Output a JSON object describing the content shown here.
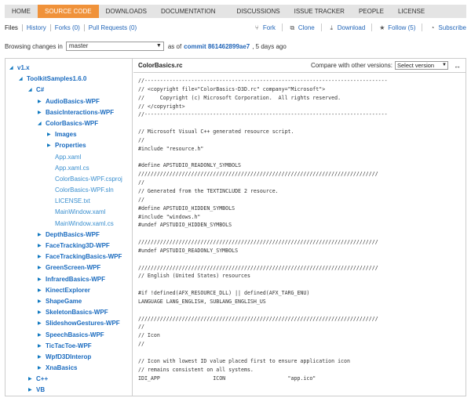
{
  "nav": {
    "tabs": [
      {
        "label": "HOME",
        "active": false
      },
      {
        "label": "SOURCE CODE",
        "active": true
      },
      {
        "label": "DOWNLOADS",
        "active": false
      },
      {
        "label": "DOCUMENTATION",
        "active": false
      },
      {
        "label": "DISCUSSIONS",
        "active": false
      },
      {
        "label": "ISSUE TRACKER",
        "active": false
      },
      {
        "label": "PEOPLE",
        "active": false
      },
      {
        "label": "LICENSE",
        "active": false
      }
    ]
  },
  "toolbar": {
    "files": "Files",
    "history": "History",
    "forks": "Forks (0)",
    "pull_requests": "Pull Requests (0)",
    "fork": "Fork",
    "clone": "Clone",
    "download": "Download",
    "follow": "Follow (5)",
    "subscribe": "Subscribe"
  },
  "browse": {
    "label": "Browsing changes in",
    "branch": "master",
    "as_of": "as of",
    "commit_label": "commit 861462899ae7",
    "age": ", 5 days ago"
  },
  "tree": [
    {
      "label": "v1.x",
      "type": "folder",
      "depth": 0,
      "expanded": true
    },
    {
      "label": "ToolkitSamples1.6.0",
      "type": "folder",
      "depth": 1,
      "expanded": true
    },
    {
      "label": "C#",
      "type": "folder",
      "depth": 2,
      "expanded": true
    },
    {
      "label": "AudioBasics-WPF",
      "type": "folder",
      "depth": 3,
      "expanded": false
    },
    {
      "label": "BasicInteractions-WPF",
      "type": "folder",
      "depth": 3,
      "expanded": false
    },
    {
      "label": "ColorBasics-WPF",
      "type": "folder",
      "depth": 3,
      "expanded": true
    },
    {
      "label": "Images",
      "type": "folder",
      "depth": 4,
      "expanded": false
    },
    {
      "label": "Properties",
      "type": "folder",
      "depth": 4,
      "expanded": false
    },
    {
      "label": "App.xaml",
      "type": "file",
      "depth": 4
    },
    {
      "label": "App.xaml.cs",
      "type": "file",
      "depth": 4
    },
    {
      "label": "ColorBasics-WPF.csproj",
      "type": "file",
      "depth": 4
    },
    {
      "label": "ColorBasics-WPF.sln",
      "type": "file",
      "depth": 4
    },
    {
      "label": "LICENSE.txt",
      "type": "file",
      "depth": 4
    },
    {
      "label": "MainWindow.xaml",
      "type": "file",
      "depth": 4
    },
    {
      "label": "MainWindow.xaml.cs",
      "type": "file",
      "depth": 4
    },
    {
      "label": "DepthBasics-WPF",
      "type": "folder",
      "depth": 3,
      "expanded": false
    },
    {
      "label": "FaceTracking3D-WPF",
      "type": "folder",
      "depth": 3,
      "expanded": false
    },
    {
      "label": "FaceTrackingBasics-WPF",
      "type": "folder",
      "depth": 3,
      "expanded": false
    },
    {
      "label": "GreenScreen-WPF",
      "type": "folder",
      "depth": 3,
      "expanded": false
    },
    {
      "label": "InfraredBasics-WPF",
      "type": "folder",
      "depth": 3,
      "expanded": false
    },
    {
      "label": "KinectExplorer",
      "type": "folder",
      "depth": 3,
      "expanded": false
    },
    {
      "label": "ShapeGame",
      "type": "folder",
      "depth": 3,
      "expanded": false
    },
    {
      "label": "SkeletonBasics-WPF",
      "type": "folder",
      "depth": 3,
      "expanded": false
    },
    {
      "label": "SlideshowGestures-WPF",
      "type": "folder",
      "depth": 3,
      "expanded": false
    },
    {
      "label": "SpeechBasics-WPF",
      "type": "folder",
      "depth": 3,
      "expanded": false
    },
    {
      "label": "TicTacToe-WPF",
      "type": "folder",
      "depth": 3,
      "expanded": false
    },
    {
      "label": "WpfD3DInterop",
      "type": "folder",
      "depth": 3,
      "expanded": false
    },
    {
      "label": "XnaBasics",
      "type": "folder",
      "depth": 3,
      "expanded": false
    },
    {
      "label": "C++",
      "type": "folder",
      "depth": 2,
      "expanded": false
    },
    {
      "label": "VB",
      "type": "folder",
      "depth": 2,
      "expanded": false
    }
  ],
  "viewer": {
    "filename": "ColorBasics.rc",
    "compare_label": "Compare with other versions:",
    "version_select": "Select version",
    "code_lines": [
      "//------------------------------------------------------------------------------",
      "// <copyright file=\"ColorBasics-D3D.rc\" company=\"Microsoft\">",
      "//     Copyright (c) Microsoft Corporation.  All rights reserved.",
      "// </copyright>",
      "//------------------------------------------------------------------------------",
      "",
      "// Microsoft Visual C++ generated resource script.",
      "//",
      "#include \"resource.h\"",
      "",
      "#define APSTUDIO_READONLY_SYMBOLS",
      "/////////////////////////////////////////////////////////////////////////////",
      "//",
      "// Generated from the TEXTINCLUDE 2 resource.",
      "//",
      "#define APSTUDIO_HIDDEN_SYMBOLS",
      "#include \"windows.h\"",
      "#undef APSTUDIO_HIDDEN_SYMBOLS",
      "",
      "/////////////////////////////////////////////////////////////////////////////",
      "#undef APSTUDIO_READONLY_SYMBOLS",
      "",
      "/////////////////////////////////////////////////////////////////////////////",
      "// English (United States) resources",
      "",
      "#if !defined(AFX_RESOURCE_DLL) || defined(AFX_TARG_ENU)",
      "LANGUAGE LANG_ENGLISH, SUBLANG_ENGLISH_US",
      "",
      "/////////////////////////////////////////////////////////////////////////////",
      "//",
      "// Icon",
      "//",
      "",
      "// Icon with lowest ID value placed first to ensure application icon",
      "// remains consistent on all systems.",
      "IDI_APP                 ICON                    \"app.ico\""
    ]
  }
}
